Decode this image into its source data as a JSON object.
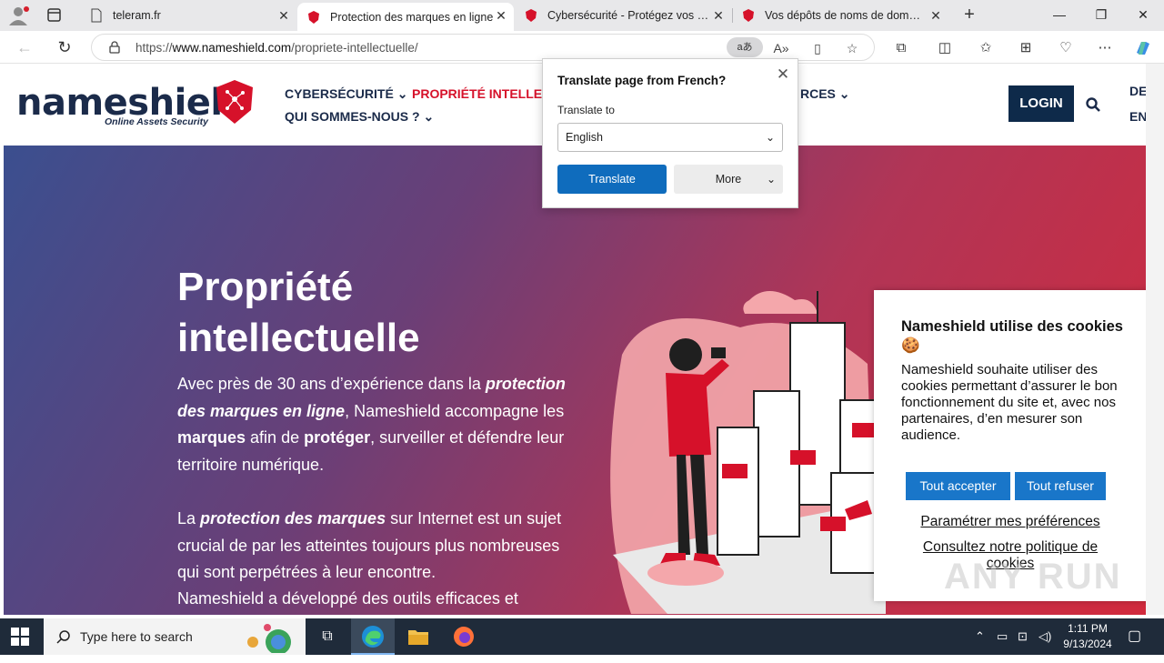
{
  "browser": {
    "tabs": [
      {
        "title": "teleram.fr"
      },
      {
        "title": "Protection des marques en ligne"
      },
      {
        "title": "Cybersécurité - Protégez vos nom"
      },
      {
        "title": "Vos dépôts de noms de domaine"
      }
    ],
    "url_prefix": "https://",
    "url_host": "www.nameshield.com",
    "url_path": "/propriete-intellectuelle/",
    "translate_pill": "aあ"
  },
  "site": {
    "logo_text_a": "name",
    "logo_text_b": "shield",
    "logo_sub": "Online Assets Security",
    "menu": {
      "cyber": "CYBERSÉCURITÉ",
      "pi": "PROPRIÉTÉ INTELLECT",
      "ressources": "RCES",
      "qui": "QUI SOMMES-NOUS ?"
    },
    "login": "LOGIN",
    "lang_de": "DE",
    "lang_en": "EN"
  },
  "hero": {
    "title": "Propriété intellectuelle",
    "p1_a": "Avec près de 30 ans d’expérience dans la ",
    "p1_b": "protection des marques en ligne",
    "p1_c": ", Nameshield accompagne les ",
    "p1_d": "marques",
    "p1_e": " afin de ",
    "p1_f": "protéger",
    "p1_g": ", surveiller et défendre leur territoire numérique.",
    "p2_a": "La ",
    "p2_b": "protection des marques",
    "p2_c": " sur Internet est un sujet crucial de par les atteintes toujours plus nombreuses qui sont perpétrées à leur encontre.",
    "p3": "Nameshield a développé des outils efficaces et"
  },
  "cookie": {
    "title": "Nameshield utilise des cookies 🍪",
    "text": "Nameshield souhaite utiliser des cookies permettant d’assurer le bon fonctionnement du site et, avec nos partenaires, d’en mesurer son audience.",
    "accept": "Tout accepter",
    "refuse": "Tout refuser",
    "prefs": "Paramétrer mes préférences",
    "policy": "Consultez notre politique de cookies"
  },
  "translate": {
    "title": "Translate page from French?",
    "label": "Translate to",
    "language": "English",
    "translate_btn": "Translate",
    "more_btn": "More"
  },
  "watermark": "ANY RUN",
  "taskbar": {
    "search_placeholder": "Type here to search",
    "time": "1:11 PM",
    "date": "9/13/2024"
  },
  "colors": {
    "brand_navy": "#1b2b4a",
    "brand_red": "#d6112a",
    "cookie_button": "#1976c9",
    "translate_button": "#0f6cbd"
  }
}
